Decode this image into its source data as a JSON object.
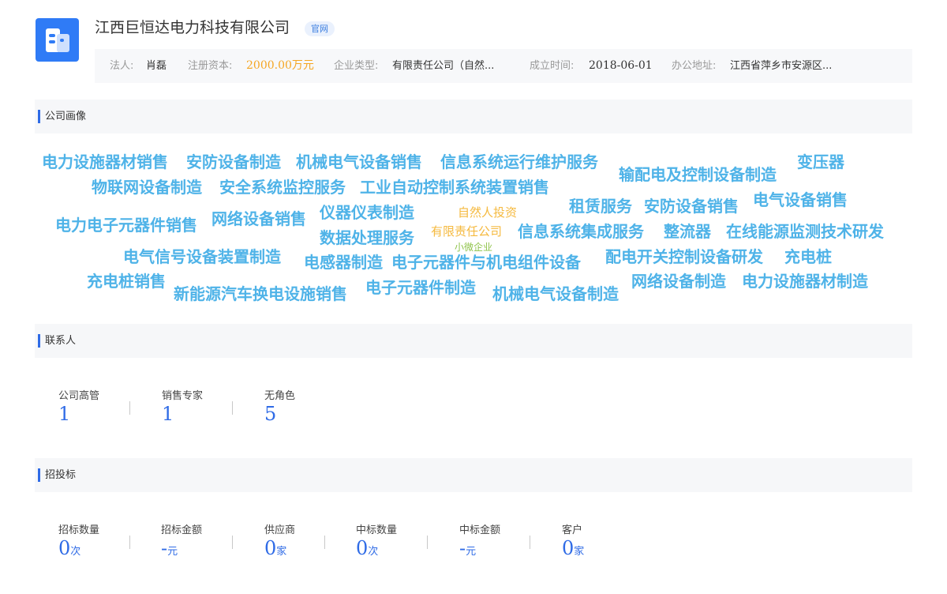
{
  "company": {
    "name": "江西巨恒达电力科技有限公司",
    "site_badge": "官网"
  },
  "info": {
    "legal_label": "法人:",
    "legal_value": "肖磊",
    "capital_label": "注册资本:",
    "capital_value": "2000.00万元",
    "type_label": "企业类型:",
    "type_value": "有限责任公司（自然...",
    "founded_label": "成立时间:",
    "founded_value": "2018-06-01",
    "address_label": "办公地址:",
    "address_value": "江西省萍乡市安源区..."
  },
  "sections": {
    "portrait": "公司画像",
    "contacts": "联系人",
    "bidding": "招投标"
  },
  "word_cloud": {
    "tags": [
      "电力设施器材销售",
      "安防设备制造",
      "机械电气设备销售",
      "信息系统运行维护服务",
      "输配电及控制设备制造",
      "变压器",
      "物联网设备制造",
      "安全系统监控服务",
      "工业自动控制系统装置销售",
      "租赁服务",
      "安防设备销售",
      "电气设备销售",
      "电力电子元器件销售",
      "网络设备销售",
      "仪器仪表制造",
      "数据处理服务",
      "信息系统集成服务",
      "整流器",
      "在线能源监测技术研发",
      "电气信号设备装置制造",
      "电感器制造",
      "电子元器件与机电组件设备",
      "配电开关控制设备研发",
      "充电桩",
      "充电桩销售",
      "新能源汽车换电设施销售",
      "电子元器件制造",
      "机械电气设备制造",
      "网络设备制造",
      "电力设施器材制造"
    ],
    "center": [
      "自然人投资",
      "有限责任公司",
      "小微企业"
    ]
  },
  "contacts": [
    {
      "label": "公司高管",
      "value": "1"
    },
    {
      "label": "销售专家",
      "value": "1"
    },
    {
      "label": "无角色",
      "value": "5"
    }
  ],
  "bidding": [
    {
      "label": "招标数量",
      "value": "0",
      "unit": "次"
    },
    {
      "label": "招标金额",
      "value": "-",
      "unit": "元"
    },
    {
      "label": "供应商",
      "value": "0",
      "unit": "家"
    },
    {
      "label": "中标数量",
      "value": "0",
      "unit": "次"
    },
    {
      "label": "中标金额",
      "value": "-",
      "unit": "元"
    },
    {
      "label": "客户",
      "value": "0",
      "unit": "家"
    }
  ]
}
